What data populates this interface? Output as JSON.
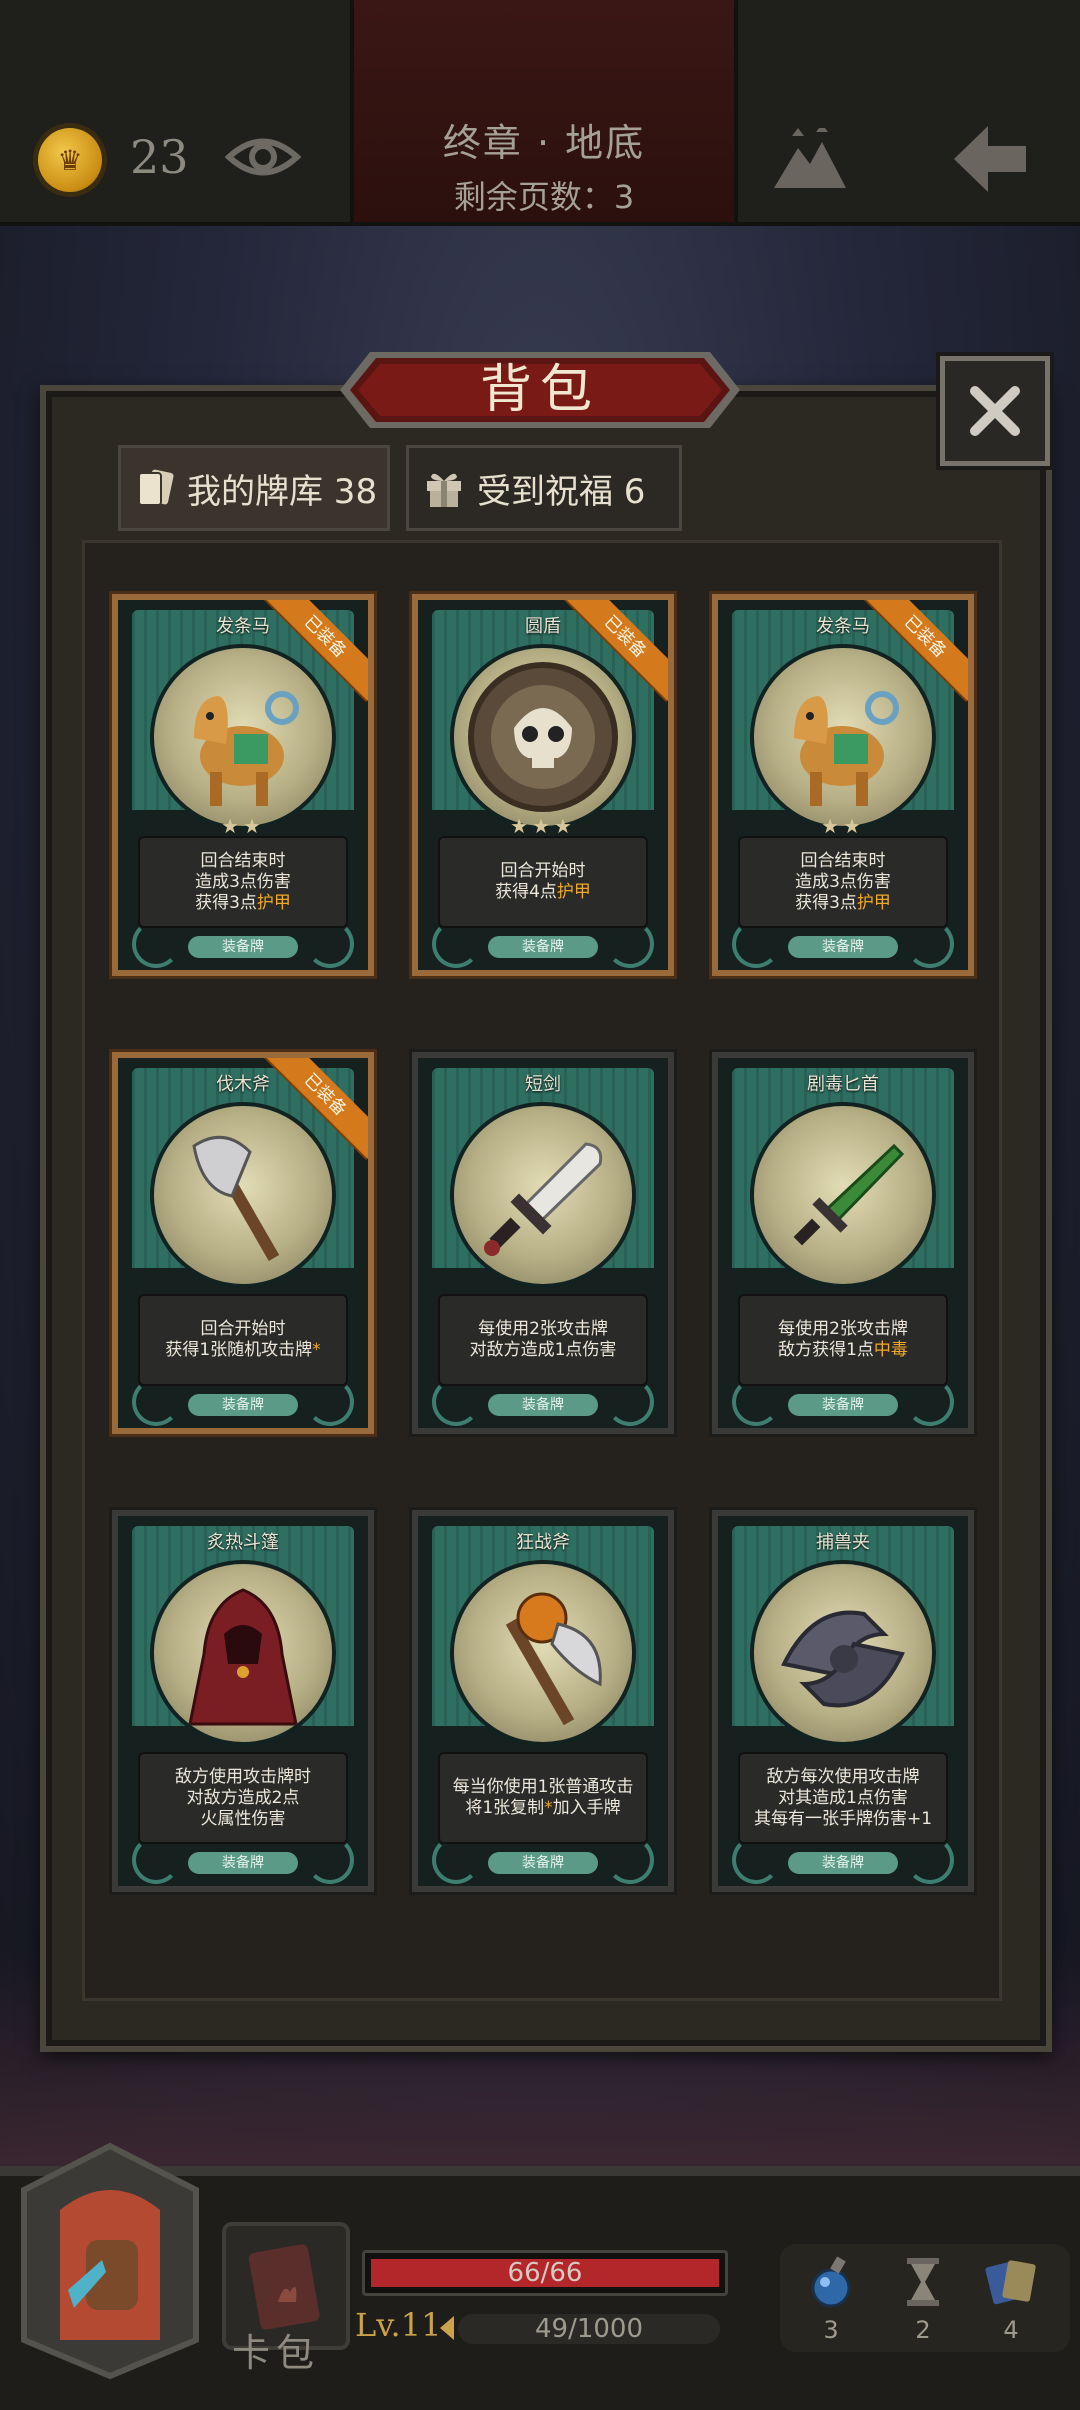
{
  "topbar": {
    "coin_count": "23",
    "chapter_title": "终章 · 地底",
    "pages_left": "剩余页数：3"
  },
  "panel": {
    "title": "背包",
    "tabs": [
      {
        "label": "我的牌库 38"
      },
      {
        "label": "受到祝福 6"
      }
    ]
  },
  "cards": [
    {
      "name": "发条马",
      "stars": "★★",
      "equipped_label": "已装备",
      "desc": [
        "回合结束时",
        "造成3点伤害",
        "获得3点|护甲"
      ],
      "type": "装备牌"
    },
    {
      "name": "圆盾",
      "stars": "★★★",
      "equipped_label": "已装备",
      "desc": [
        "回合开始时",
        "获得4点|护甲"
      ],
      "type": "装备牌"
    },
    {
      "name": "发条马",
      "stars": "★★",
      "equipped_label": "已装备",
      "desc": [
        "回合结束时",
        "造成3点伤害",
        "获得3点|护甲"
      ],
      "type": "装备牌"
    },
    {
      "name": "伐木斧",
      "stars": "",
      "equipped_label": "已装备",
      "desc": [
        "回合开始时",
        "获得1张随机攻击牌|*"
      ],
      "type": "装备牌"
    },
    {
      "name": "短剑",
      "stars": "",
      "equipped_label": "",
      "desc": [
        "每使用2张攻击牌",
        "对敌方造成1点伤害"
      ],
      "type": "装备牌"
    },
    {
      "name": "剧毒匕首",
      "stars": "",
      "equipped_label": "",
      "desc": [
        "每使用2张攻击牌",
        "敌方获得1点|中毒"
      ],
      "type": "装备牌"
    },
    {
      "name": "炙热斗篷",
      "stars": "",
      "equipped_label": "",
      "desc": [
        "敌方使用攻击牌时",
        "对敌方造成2点",
        "火属性伤害"
      ],
      "type": "装备牌"
    },
    {
      "name": "狂战斧",
      "stars": "",
      "equipped_label": "",
      "desc": [
        "每当你使用1张普通攻击",
        "将1张复制|*|加入手牌"
      ],
      "type": "装备牌"
    },
    {
      "name": "捕兽夹",
      "stars": "",
      "equipped_label": "",
      "desc": [
        "敌方每次使用攻击牌",
        "对其造成1点伤害",
        "其每有一张手牌伤害+1"
      ],
      "type": "装备牌"
    }
  ],
  "hud": {
    "hp_text": "66/66",
    "hp_fraction": 1.0,
    "bag_label": "卡包",
    "level": "Lv.11",
    "xp_text": "49/1000",
    "items": [
      {
        "icon": "potion-icon",
        "count": "3"
      },
      {
        "icon": "hourglass-icon",
        "count": "2"
      },
      {
        "icon": "cards-icon",
        "count": "4"
      }
    ]
  }
}
